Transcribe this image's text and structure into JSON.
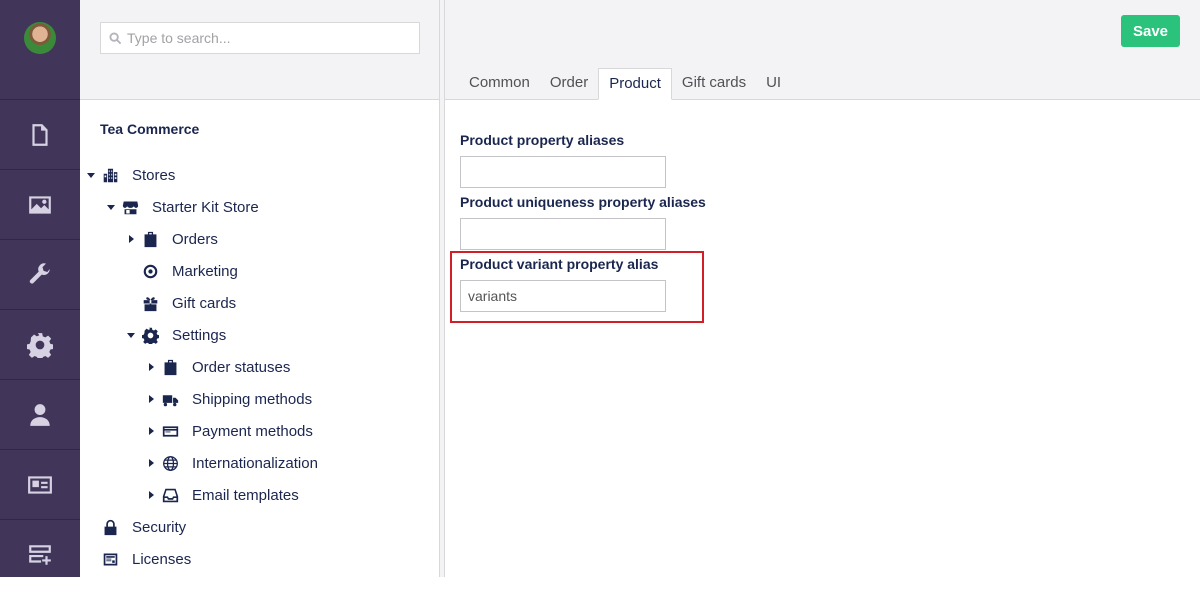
{
  "rail": {
    "sections": [
      {
        "icon": "document-icon"
      },
      {
        "icon": "image-icon"
      },
      {
        "icon": "wrench-icon"
      },
      {
        "icon": "gear-icon"
      },
      {
        "icon": "user-icon"
      },
      {
        "icon": "id-card-icon"
      },
      {
        "icon": "forms-add-icon"
      }
    ]
  },
  "search": {
    "placeholder": "Type to search..."
  },
  "tree": {
    "title": "Tea Commerce",
    "nodes": [
      {
        "label": "Stores",
        "icon": "stores-icon",
        "expanded": true
      },
      {
        "label": "Starter Kit Store",
        "icon": "shop-icon",
        "expanded": true
      },
      {
        "label": "Orders",
        "icon": "bag-icon",
        "expanded": false
      },
      {
        "label": "Marketing",
        "icon": "target-icon"
      },
      {
        "label": "Gift cards",
        "icon": "gift-icon"
      },
      {
        "label": "Settings",
        "icon": "settings-gear-icon",
        "expanded": true
      },
      {
        "label": "Order statuses",
        "icon": "bag-icon",
        "expanded": false
      },
      {
        "label": "Shipping methods",
        "icon": "truck-icon",
        "expanded": false
      },
      {
        "label": "Payment methods",
        "icon": "credit-card-icon",
        "expanded": false
      },
      {
        "label": "Internationalization",
        "icon": "globe-icon",
        "expanded": false
      },
      {
        "label": "Email templates",
        "icon": "inbox-icon",
        "expanded": false
      },
      {
        "label": "Security",
        "icon": "lock-icon"
      },
      {
        "label": "Licenses",
        "icon": "license-icon"
      }
    ]
  },
  "editor": {
    "save_label": "Save",
    "tabs": [
      {
        "label": "Common"
      },
      {
        "label": "Order"
      },
      {
        "label": "Product",
        "active": true
      },
      {
        "label": "Gift cards"
      },
      {
        "label": "UI"
      }
    ],
    "fields": [
      {
        "label": "Product property aliases",
        "value": ""
      },
      {
        "label": "Product uniqueness property aliases",
        "value": ""
      },
      {
        "label": "Product variant property alias",
        "value": "variants"
      }
    ]
  },
  "colors": {
    "rail": "#413659",
    "save": "#2bc37c",
    "highlight": "#d11f27",
    "text": "#1b264f"
  }
}
